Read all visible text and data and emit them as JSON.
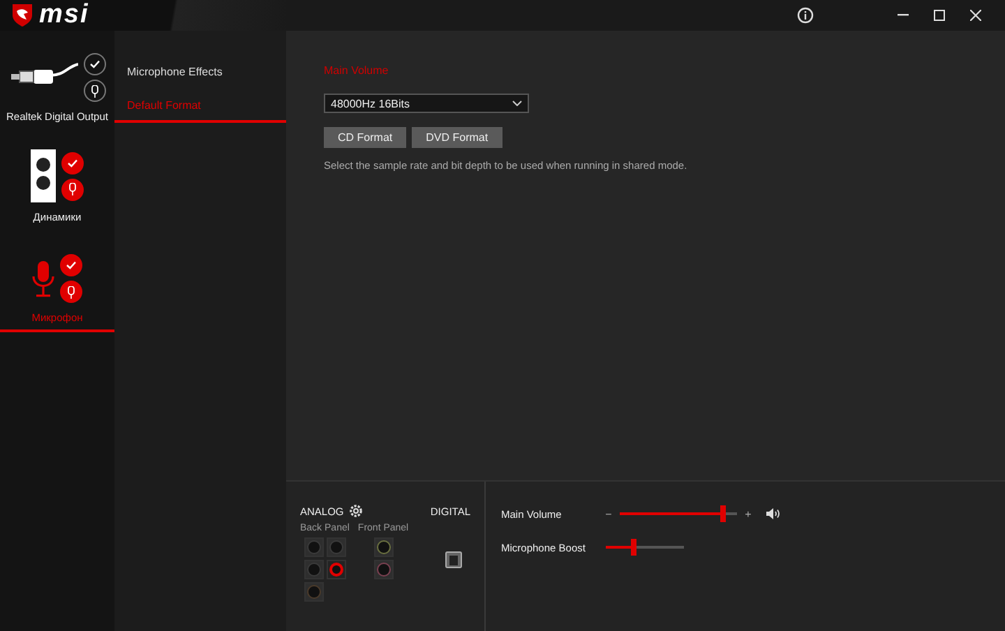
{
  "logo": {
    "text": "msi"
  },
  "window_buttons": [
    {
      "kind": "info"
    },
    {
      "kind": "minimize"
    },
    {
      "kind": "maximize"
    },
    {
      "kind": "close"
    }
  ],
  "devices": [
    {
      "name": "Realtek Digital Output",
      "kind": "spdif",
      "default": false,
      "selected": false
    },
    {
      "name": "Динамики",
      "kind": "speaker",
      "default": true,
      "selected": false
    },
    {
      "name": "Микрофон",
      "kind": "mic",
      "default": true,
      "selected": true
    }
  ],
  "tabs": [
    {
      "label": "Microphone Effects",
      "selected": false
    },
    {
      "label": "Default Format",
      "selected": true
    }
  ],
  "content": {
    "heading": "Main Volume",
    "format_select": {
      "value": "48000Hz 16Bits"
    },
    "buttons": [
      "CD Format",
      "DVD Format"
    ],
    "description": "Select the sample rate and bit depth to be used when running in shared mode."
  },
  "jacks": {
    "analog_label": "ANALOG",
    "digital_label": "DIGITAL",
    "back_panel": {
      "label": "Back Panel",
      "jacks": [
        {
          "color": "#3a3a3a",
          "active": false
        },
        {
          "color": "#3a3a3a",
          "active": false
        },
        {
          "color": "#3a3a3a",
          "active": false
        },
        {
          "color": "#e00000",
          "active": true
        },
        {
          "color": "#4a3a2a",
          "active": false
        }
      ]
    },
    "front_panel": {
      "label": "Front Panel",
      "jacks": [
        {
          "color": "#6a7040",
          "active": false
        },
        {
          "color": "#7a4050",
          "active": false
        }
      ]
    }
  },
  "sliders": [
    {
      "label": "Main Volume",
      "level": 0.88,
      "kind": "volume",
      "minus": "−",
      "plus": "+"
    },
    {
      "label": "Microphone Boost",
      "level": 0.36,
      "kind": "boost"
    }
  ]
}
